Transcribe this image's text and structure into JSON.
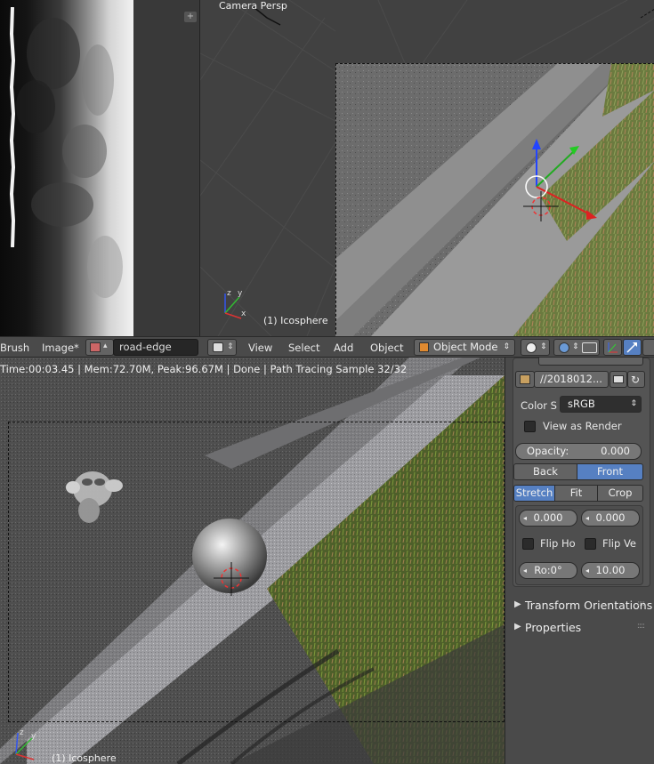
{
  "image_editor": {
    "header": {
      "brush_label": "Brush",
      "image_menu": "Image*",
      "image_name": "road-edge"
    }
  },
  "viewport_top": {
    "label": "Camera Persp",
    "object_label": "(1) Icosphere",
    "menus": [
      "View",
      "Select",
      "Add",
      "Object"
    ],
    "mode": "Object Mode"
  },
  "render_view": {
    "status": "Time:00:03.45 | Mem:72.70M, Peak:96.67M | Done | Path Tracing Sample 32/32",
    "object_label": "(1) Icosphere"
  },
  "properties": {
    "image_path": "//2018012...",
    "color_space_label": "Color S",
    "color_space_value": "sRGB",
    "view_as_render": "View as Render",
    "opacity_label": "Opacity:",
    "opacity_value": "0.000",
    "back_label": "Back",
    "front_label": "Front",
    "stretch_label": "Stretch",
    "fit_label": "Fit",
    "crop_label": "Crop",
    "offset_x": "0.000",
    "offset_y": "0.000",
    "flip_h": "Flip Ho",
    "flip_v": "Flip Ve",
    "rotation": "Ro:0°",
    "size": "10.00",
    "sections": [
      "Transform Orientations",
      "Properties"
    ]
  },
  "colors": {
    "accent_blue": "#5680c2",
    "header_bg": "#4a4a4a",
    "panel_bg": "#545454"
  }
}
